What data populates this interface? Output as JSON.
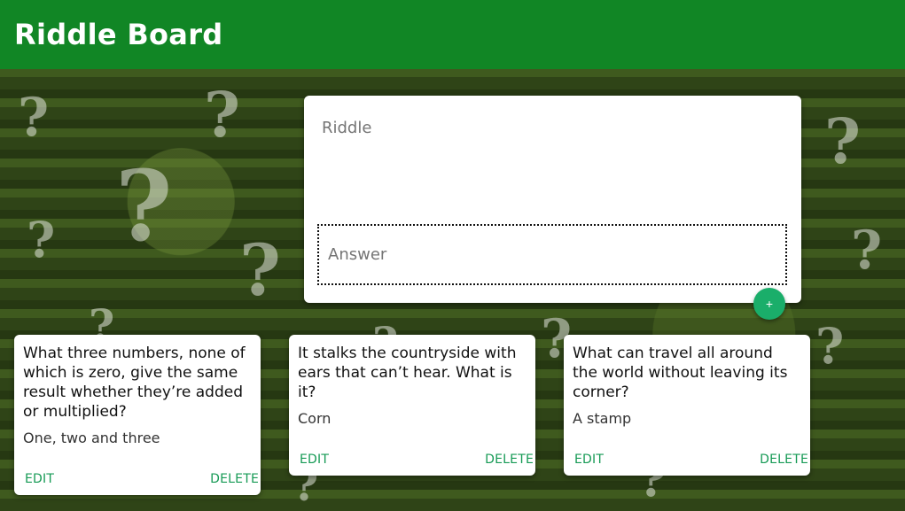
{
  "header": {
    "title": "Riddle Board"
  },
  "form": {
    "riddle_placeholder": "Riddle",
    "answer_placeholder": "Answer",
    "add_label": "+"
  },
  "cards": [
    {
      "question": "What three numbers, none of which is zero, give the same result whether they’re added or multiplied?",
      "answer": "One, two and three",
      "edit_label": "EDIT",
      "delete_label": "DELETE"
    },
    {
      "question": "It stalks the countryside with ears that can’t hear. What is it?",
      "answer": "Corn",
      "edit_label": "EDIT",
      "delete_label": "DELETE"
    },
    {
      "question": "What can travel all around the world without leaving its corner?",
      "answer": "A stamp",
      "edit_label": "EDIT",
      "delete_label": "DELETE"
    }
  ],
  "colors": {
    "header": "#118625",
    "accent": "#1aae6a",
    "action_text": "#169a55"
  }
}
